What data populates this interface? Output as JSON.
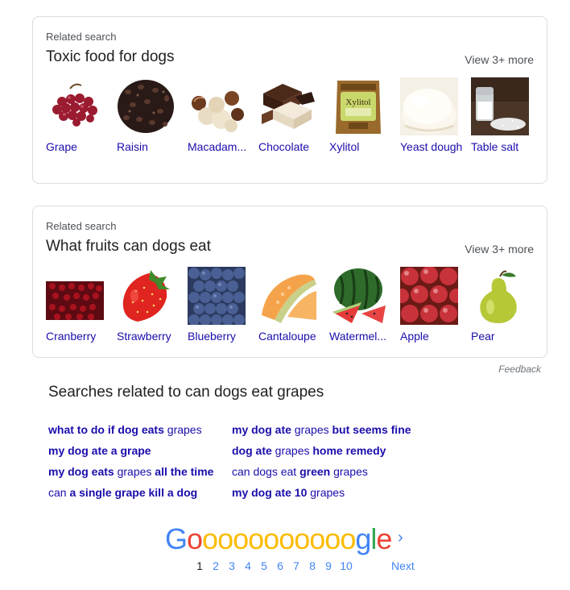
{
  "card1": {
    "label": "Related search",
    "title": "Toxic food for dogs",
    "view_more": "View 3+ more",
    "items": [
      {
        "label": "Grape"
      },
      {
        "label": "Raisin"
      },
      {
        "label": "Macadam..."
      },
      {
        "label": "Chocolate"
      },
      {
        "label": "Xylitol"
      },
      {
        "label": "Yeast dough"
      },
      {
        "label": "Table salt"
      }
    ]
  },
  "card2": {
    "label": "Related search",
    "title": "What fruits can dogs eat",
    "view_more": "View 3+ more",
    "items": [
      {
        "label": "Cranberry"
      },
      {
        "label": "Strawberry"
      },
      {
        "label": "Blueberry"
      },
      {
        "label": "Cantaloupe"
      },
      {
        "label": "Watermel..."
      },
      {
        "label": "Apple"
      },
      {
        "label": "Pear"
      }
    ]
  },
  "feedback": "Feedback",
  "related": {
    "title": "Searches related to can dogs eat grapes",
    "col1": [
      [
        {
          "t": "what to do if dog eats",
          "b": true
        },
        {
          "t": " grapes",
          "b": false
        }
      ],
      [
        {
          "t": "my dog ate a grape",
          "b": true
        }
      ],
      [
        {
          "t": "my dog eats",
          "b": true
        },
        {
          "t": " grapes ",
          "b": false
        },
        {
          "t": "all the time",
          "b": true
        }
      ],
      [
        {
          "t": "can ",
          "b": false
        },
        {
          "t": "a single grape kill a dog",
          "b": true
        }
      ]
    ],
    "col2": [
      [
        {
          "t": "my dog ate",
          "b": true
        },
        {
          "t": " grapes ",
          "b": false
        },
        {
          "t": "but seems fine",
          "b": true
        }
      ],
      [
        {
          "t": "dog ate",
          "b": true
        },
        {
          "t": " grapes ",
          "b": false
        },
        {
          "t": "home remedy",
          "b": true
        }
      ],
      [
        {
          "t": "can dogs eat ",
          "b": false
        },
        {
          "t": "green",
          "b": true
        },
        {
          "t": " grapes",
          "b": false
        }
      ],
      [
        {
          "t": "my dog ate 10",
          "b": true
        },
        {
          "t": " grapes",
          "b": false
        }
      ]
    ]
  },
  "pagination": {
    "logo_letters": [
      "G",
      "o",
      "o",
      "o",
      "o",
      "o",
      "o",
      "o",
      "o",
      "o",
      "o",
      "o",
      "g",
      "l",
      "e"
    ],
    "logo_colors": [
      "#4285f4",
      "#ea4335",
      "#fbbc05",
      "#fbbc05",
      "#fbbc05",
      "#fbbc05",
      "#fbbc05",
      "#fbbc05",
      "#fbbc05",
      "#fbbc05",
      "#fbbc05",
      "#fbbc05",
      "#4285f4",
      "#34a853",
      "#ea4335"
    ],
    "arrow": "›",
    "pages": [
      "1",
      "2",
      "3",
      "4",
      "5",
      "6",
      "7",
      "8",
      "9",
      "10"
    ],
    "current": "1",
    "next": "Next"
  }
}
